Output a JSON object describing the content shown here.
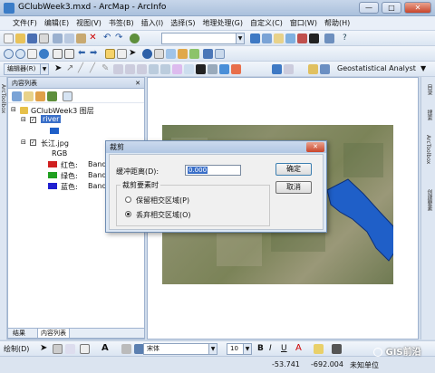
{
  "window": {
    "title": "GClubWeek3.mxd - ArcMap - ArcInfo",
    "min": "—",
    "max": "□",
    "close": "✕"
  },
  "menu": [
    "文件(F)",
    "编辑(E)",
    "视图(V)",
    "书签(B)",
    "插入(I)",
    "选择(S)",
    "地理处理(G)",
    "自定义(C)",
    "窗口(W)",
    "帮助(H)"
  ],
  "toolbar": {
    "scale_placeholder": "",
    "help_glyph": "?",
    "editor_label": "编辑器(R)",
    "geostat_label": "Geostatistical Analyst"
  },
  "left_strip": {
    "label": "ArcToolbox"
  },
  "toc": {
    "title": "内容列表",
    "close": "✕",
    "data_frame": "GClubWeek3 图层",
    "layer_river": "river",
    "layer_image": "长江.jpg",
    "rgb": "RGB",
    "bands": [
      {
        "label": "红色:",
        "band": "Band_1",
        "color": "#d02020"
      },
      {
        "label": "绿色:",
        "band": "Band_2",
        "color": "#20a020"
      },
      {
        "label": "蓝色:",
        "band": "Band_3",
        "color": "#2020d0"
      }
    ],
    "river_color": "#1f5fc8",
    "tabs": [
      "结果",
      "内容列表"
    ]
  },
  "right_strip": {
    "labels": [
      "目录",
      "搜索",
      "ArcToolbox",
      "创建要素"
    ]
  },
  "dialog": {
    "title": "裁剪",
    "close": "✕",
    "distance_label": "缓冲距离(D):",
    "distance_value": "0.000",
    "ok": "确定",
    "cancel": "取消",
    "group_label": "裁剪要素时",
    "option_keep": "保留相交区域(P)",
    "option_remove": "丢弃相交区域(O)",
    "selected_option": "remove"
  },
  "drawbar": {
    "draw_label": "绘制(D)",
    "font": "宋体",
    "size": "10"
  },
  "status": {
    "x": "-53.741",
    "y": "-692.004",
    "units": "未知单位"
  },
  "watermark": "GIS前沿",
  "colors": {
    "river_fill": "#1f5fc8",
    "accent": "#3a6fc8"
  }
}
